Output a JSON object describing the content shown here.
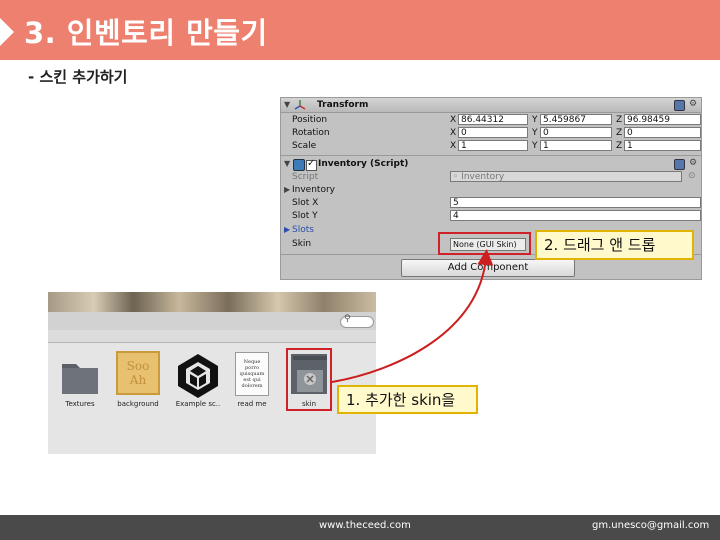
{
  "header": {
    "title": "3. 인벤토리 만들기"
  },
  "subtitle": "- 스킨 추가하기",
  "inspector": {
    "transform": {
      "title": "Transform",
      "rows": [
        {
          "label": "Position",
          "x": "86.44312",
          "y": "5.459867",
          "z": "96.98459"
        },
        {
          "label": "Rotation",
          "x": "0",
          "y": "0",
          "z": "0"
        },
        {
          "label": "Scale",
          "x": "1",
          "y": "1",
          "z": "1"
        }
      ],
      "axes": {
        "x": "X",
        "y": "Y",
        "z": "Z"
      }
    },
    "inventory": {
      "title": "Inventory (Script)",
      "script_label": "Script",
      "script_value": "Inventory",
      "inventory_label": "Inventory",
      "slot_x_label": "Slot X",
      "slot_x_value": "5",
      "slot_y_label": "Slot Y",
      "slot_y_value": "4",
      "slots_label": "Slots",
      "skin_label": "Skin",
      "skin_value": "None (GUI Skin)"
    },
    "add_component": "Add Component"
  },
  "callouts": {
    "drag": "2. 드래그 앤 드롭",
    "added_skin": "1. 추가한 skin을"
  },
  "project": {
    "assets": [
      {
        "label": "Textures",
        "icon": "folder-icon"
      },
      {
        "label": "background",
        "icon": "texture-thumbnail",
        "thumb_text": "Soo Ah"
      },
      {
        "label": "Example sc..",
        "icon": "unity-icon"
      },
      {
        "label": "read me",
        "icon": "document-icon",
        "doc_text": "Neque porro quisquam est qui dolorem"
      },
      {
        "label": "skin",
        "icon": "guiskin-icon"
      }
    ]
  },
  "footer": {
    "website": "www.theceed.com",
    "email": "gm.unesco@gmail.com"
  },
  "colors": {
    "header": "#ee8070",
    "highlight": "#d0202a",
    "callout_bg": "#fff9cc",
    "callout_border": "#e0b400",
    "footer": "#4a4a4a"
  }
}
